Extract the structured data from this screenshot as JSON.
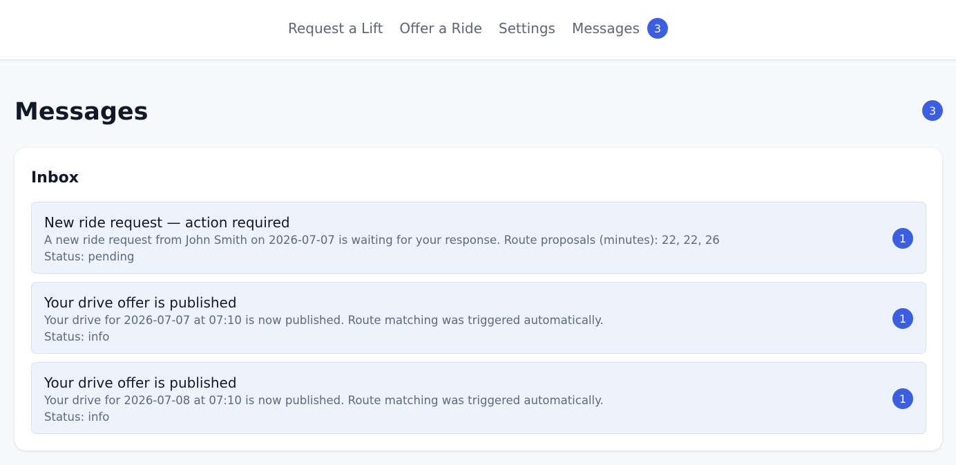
{
  "nav": {
    "items": [
      {
        "label": "Request a Lift"
      },
      {
        "label": "Offer a Ride"
      },
      {
        "label": "Settings"
      },
      {
        "label": "Messages",
        "badge": "3"
      }
    ]
  },
  "page": {
    "title": "Messages",
    "badge": "3"
  },
  "inbox": {
    "title": "Inbox",
    "messages": [
      {
        "title": "New ride request — action required",
        "body": "A new ride request from John Smith on 2026-07-07 is waiting for your response. Route proposals (minutes): 22, 22, 26",
        "status": "Status: pending",
        "badge": "1"
      },
      {
        "title": "Your drive offer is published",
        "body": "Your drive for 2026-07-07 at 07:10 is now published. Route matching was triggered automatically.",
        "status": "Status: info",
        "badge": "1"
      },
      {
        "title": "Your drive offer is published",
        "body": "Your drive for 2026-07-08 at 07:10 is now published. Route matching was triggered automatically.",
        "status": "Status: info",
        "badge": "1"
      }
    ]
  },
  "colors": {
    "accent": "#3b5fe0",
    "message_bg": "#edf3fd",
    "page_bg": "#f8f9fb"
  }
}
